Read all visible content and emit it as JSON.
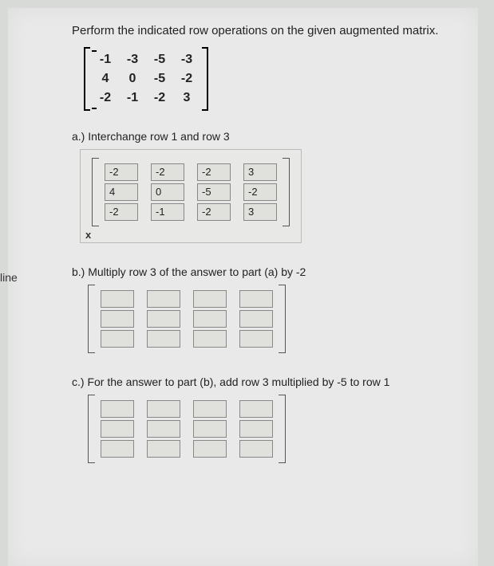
{
  "side_label": "line",
  "instruction": "Perform the indicated row operations on the given augmented matrix.",
  "given_matrix": [
    [
      "-1",
      "-3",
      "-5",
      "-3"
    ],
    [
      "4",
      "0",
      "-5",
      "-2"
    ],
    [
      "-2",
      "-1",
      "-2",
      "3"
    ]
  ],
  "parts": {
    "a": {
      "label": "a.) Interchange row 1 and row 3",
      "values": [
        [
          "-2",
          "-2",
          "-2",
          "3"
        ],
        [
          "4",
          "0",
          "-5",
          "-2"
        ],
        [
          "-2",
          "-1",
          "-2",
          "3"
        ]
      ],
      "mark": "x"
    },
    "b": {
      "label": "b.) Multiply row 3 of the answer to part (a) by -2",
      "values": [
        [
          "",
          "",
          "",
          ""
        ],
        [
          "",
          "",
          "",
          ""
        ],
        [
          "",
          "",
          "",
          ""
        ]
      ]
    },
    "c": {
      "label": "c.) For the answer to part (b), add row 3 multiplied by -5 to row 1",
      "values": [
        [
          "",
          "",
          "",
          ""
        ],
        [
          "",
          "",
          "",
          ""
        ],
        [
          "",
          "",
          "",
          ""
        ]
      ]
    }
  }
}
